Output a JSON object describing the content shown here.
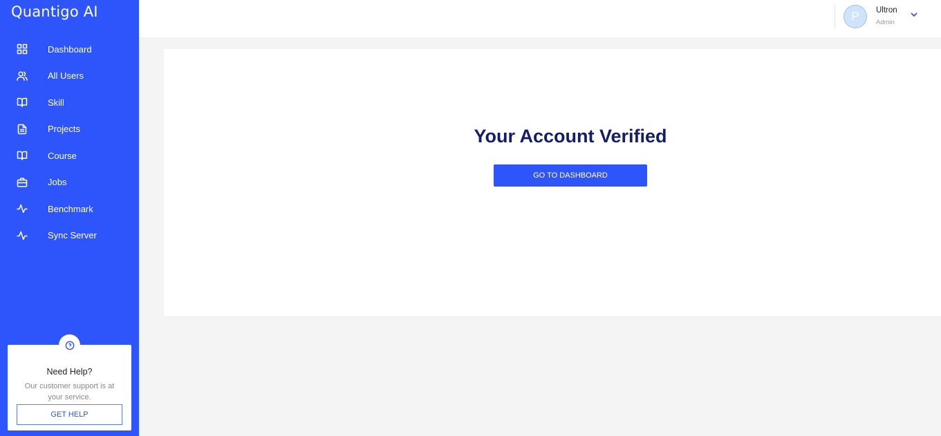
{
  "app": {
    "brand": "Quantigo AI"
  },
  "sidebar": {
    "items": [
      {
        "label": "Dashboard",
        "icon": "grid-icon"
      },
      {
        "label": "All Users",
        "icon": "users-icon"
      },
      {
        "label": "Skill",
        "icon": "book-open-icon"
      },
      {
        "label": "Projects",
        "icon": "file-text-icon"
      },
      {
        "label": "Course",
        "icon": "book-open-icon"
      },
      {
        "label": "Jobs",
        "icon": "briefcase-icon"
      },
      {
        "label": "Benchmark",
        "icon": "activity-icon"
      },
      {
        "label": "Sync Server",
        "icon": "activity-icon"
      }
    ],
    "help": {
      "title": "Need Help?",
      "text": "Our customer support is at your service.",
      "button": "GET HELP"
    }
  },
  "header": {
    "avatar_initial": "P",
    "user_name": "Ultron",
    "user_role": "Admin"
  },
  "main": {
    "title": "Your Account Verified",
    "button": "GO TO DASHBOARD"
  },
  "colors": {
    "accent": "#2e55fb",
    "title": "#141c6e",
    "background": "#f4f4f4"
  }
}
